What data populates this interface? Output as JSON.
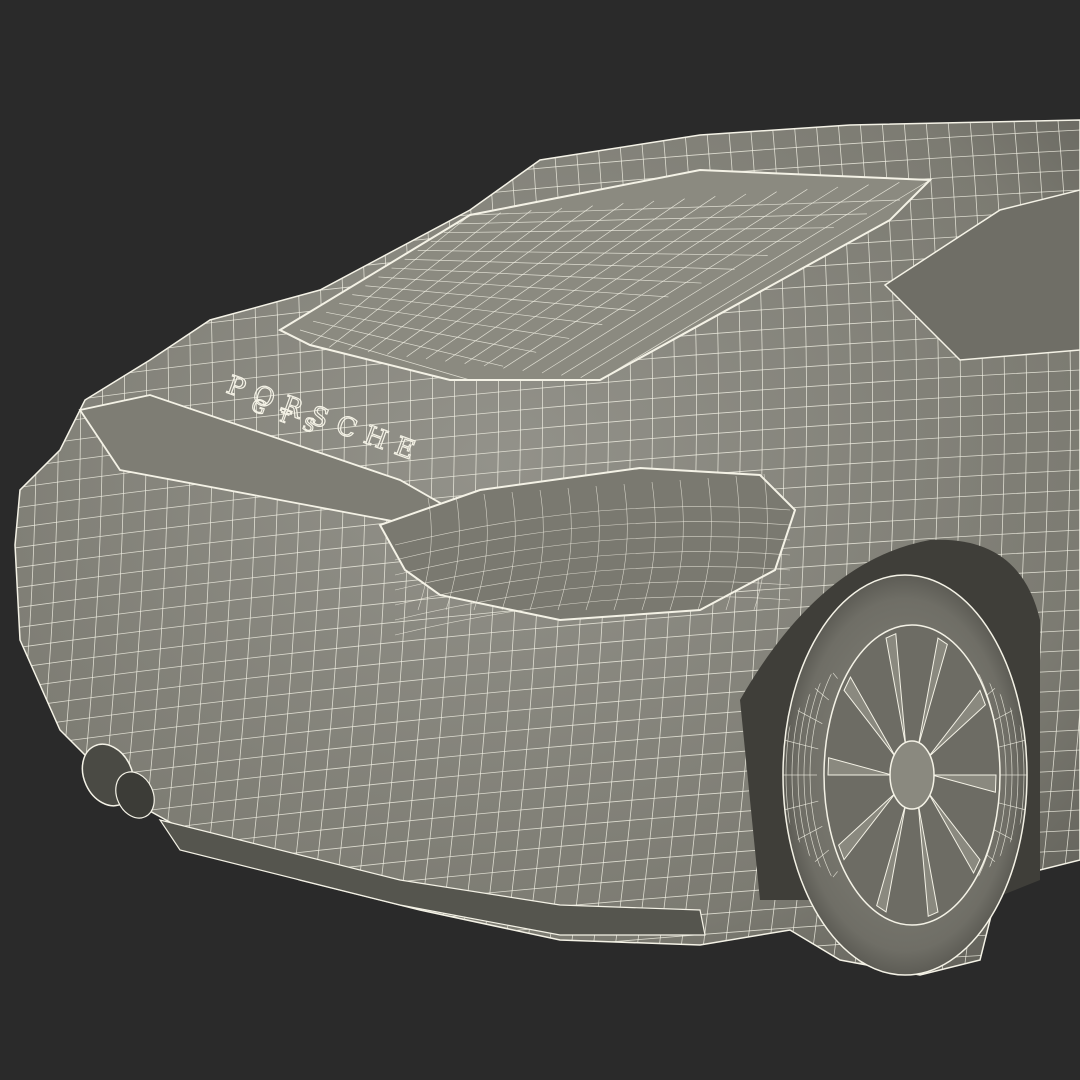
{
  "scene": {
    "subject": "car-wireframe-render",
    "background_color": "#2a2a2a",
    "body_color": "#858479",
    "shadow_color": "#5a5a52",
    "wire_color": "#f4f2e6"
  },
  "badge": {
    "brand_text": "PORSCHE",
    "model_text": "GTS"
  }
}
